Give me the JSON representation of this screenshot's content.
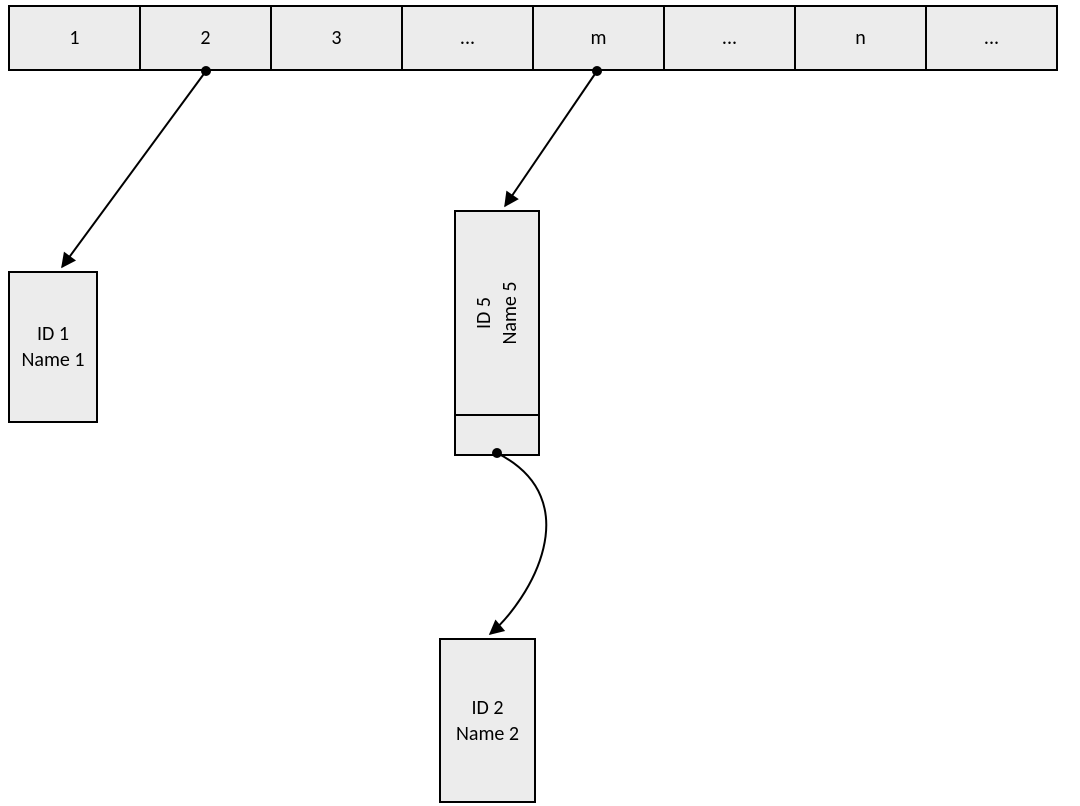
{
  "array": {
    "cells": [
      "1",
      "2",
      "3",
      "...",
      "m",
      "...",
      "n",
      "..."
    ]
  },
  "nodes": {
    "n1": {
      "id": "ID 1",
      "name": "Name 1"
    },
    "n5": {
      "id": "ID 5",
      "name": "Name 5"
    },
    "n2": {
      "id": "ID 2",
      "name": "Name 2"
    }
  },
  "edges": [
    {
      "from": "array[2]",
      "to": "node1"
    },
    {
      "from": "array[m]",
      "to": "node5"
    },
    {
      "from": "node5.next",
      "to": "node2"
    }
  ]
}
